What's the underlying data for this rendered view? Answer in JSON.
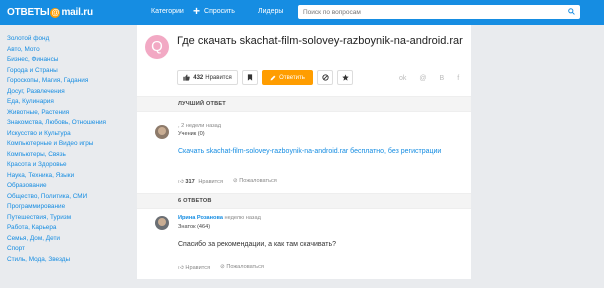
{
  "header": {
    "logo_prefix": "ОТВЕТЫ",
    "logo_at": "@",
    "logo_suffix": "mail.ru",
    "nav": [
      {
        "label": "Категории",
        "icon": "grid-icon"
      },
      {
        "label": "Спросить",
        "icon": "plus-icon"
      },
      {
        "label": "Лидеры",
        "icon": "bar-chart-icon"
      }
    ],
    "search_placeholder": "Поиск по вопросам"
  },
  "sidebar": {
    "items": [
      "Золотой фонд",
      "Авто, Мото",
      "Бизнес, Финансы",
      "Города и Страны",
      "Гороскопы, Магия, Гадания",
      "Досуг, Развлечения",
      "Еда, Кулинария",
      "Животные, Растения",
      "Знакомства, Любовь, Отношения",
      "Искусство и Культура",
      "Компьютерные и Видео игры",
      "Компьютеры, Связь",
      "Красота и Здоровье",
      "Наука, Техника, Языки",
      "Образование",
      "Общество, Политика, СМИ",
      "Программирование",
      "Путешествия, Туризм",
      "Работа, Карьера",
      "Семья, Дом, Дети",
      "Спорт",
      "Стиль, Мода, Звезды"
    ]
  },
  "question": {
    "avatar_letter": "Q",
    "title": "Где скачать skachat-film-solovey-razboynik-na-android.rar",
    "like_count": "432",
    "like_label": "Нравится",
    "answer_label": "Ответить",
    "social": [
      "ok",
      "@",
      "B",
      "f"
    ]
  },
  "best_answer": {
    "section_title": "ЛУЧШИЙ ОТВЕТ",
    "time": ", 2 недели назад",
    "rank": "Ученик (0)",
    "text": "Скачать skachat-film-solovey-razboynik-na-android.rar бесплатно, без регистрации",
    "likes": "317",
    "like_label": "Нравится",
    "complain_label": "Пожаловаться"
  },
  "answers": {
    "section_title": "6 ОТВЕТОВ",
    "items": [
      {
        "author": "Ирина Розанова",
        "time": " неделю назад",
        "rank": "Знаток (464)",
        "text": "Спасибо за рекомендации, а как там скачивать?",
        "like_label": "Нравится",
        "complain_label": "Пожаловаться"
      }
    ]
  },
  "colors": {
    "header": "#168de2",
    "accent_orange": "#ff9d00",
    "link": "#168de2"
  }
}
